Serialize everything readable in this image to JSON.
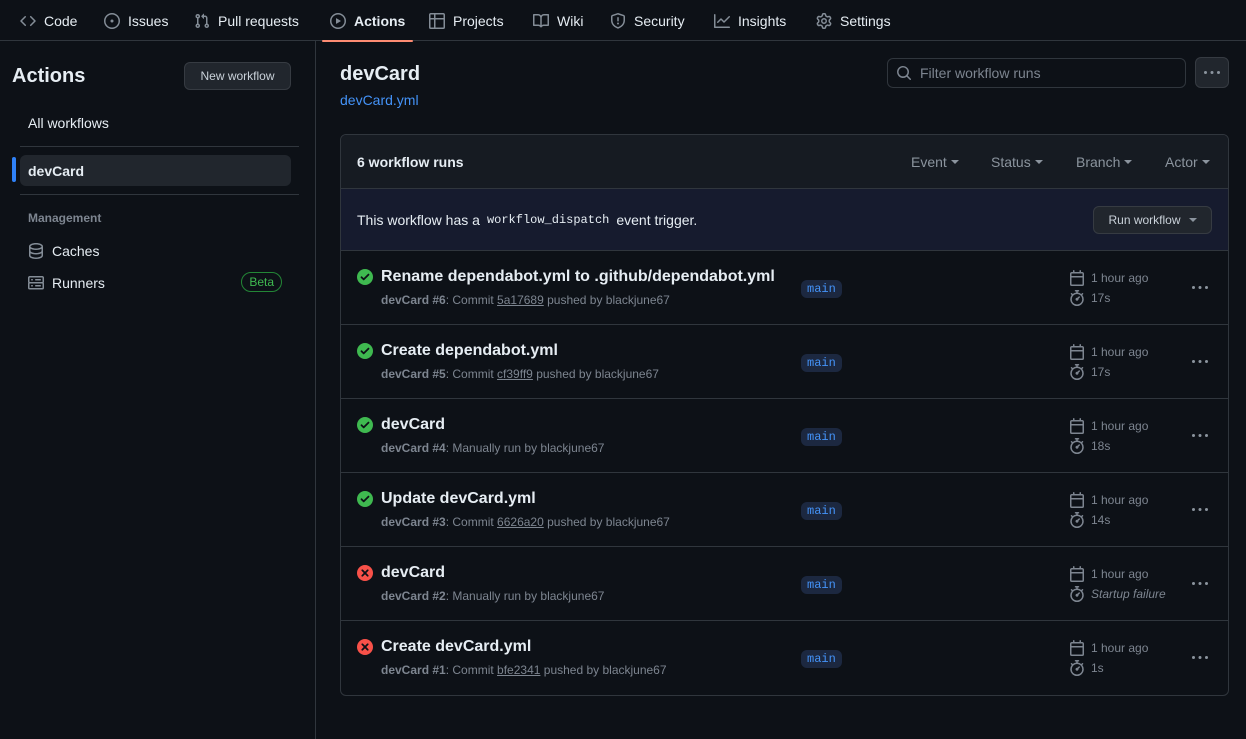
{
  "topnav": {
    "tabs": [
      {
        "label": "Code",
        "icon": "code-icon"
      },
      {
        "label": "Issues",
        "icon": "issue-opened-icon"
      },
      {
        "label": "Pull requests",
        "icon": "git-pull-request-icon"
      },
      {
        "label": "Actions",
        "icon": "play-icon",
        "selected": true
      },
      {
        "label": "Projects",
        "icon": "table-icon"
      },
      {
        "label": "Wiki",
        "icon": "book-icon"
      },
      {
        "label": "Security",
        "icon": "shield-icon"
      },
      {
        "label": "Insights",
        "icon": "graph-icon"
      },
      {
        "label": "Settings",
        "icon": "gear-icon"
      }
    ]
  },
  "sidebar": {
    "title": "Actions",
    "new_workflow_label": "New workflow",
    "all_workflows_label": "All workflows",
    "workflows": [
      {
        "label": "devCard",
        "active": true
      }
    ],
    "management_heading": "Management",
    "management_items": [
      {
        "label": "Caches",
        "icon": "database-icon"
      },
      {
        "label": "Runners",
        "icon": "server-icon",
        "badge": "Beta"
      }
    ]
  },
  "main": {
    "workflow_name": "devCard",
    "workflow_file": "devCard.yml",
    "search_placeholder": "Filter workflow runs",
    "runs_count": "6 workflow runs",
    "filters": [
      "Event",
      "Status",
      "Branch",
      "Actor"
    ],
    "dispatch": {
      "prefix": "This workflow has a",
      "code": "workflow_dispatch",
      "suffix": "event trigger.",
      "button_label": "Run workflow"
    },
    "runs": [
      {
        "title": "Rename dependabot.yml to .github/dependabot.yml",
        "status": "success",
        "workflow": "devCard #6",
        "sep": ": ",
        "desc_prefix": "Commit ",
        "sha": "5a17689",
        "desc_suffix": " pushed by blackjune67",
        "branch": "main",
        "time": "1 hour ago",
        "duration": "17s"
      },
      {
        "title": "Create dependabot.yml",
        "status": "success",
        "workflow": "devCard #5",
        "sep": ": ",
        "desc_prefix": "Commit ",
        "sha": "cf39ff9",
        "desc_suffix": " pushed by blackjune67",
        "branch": "main",
        "time": "1 hour ago",
        "duration": "17s"
      },
      {
        "title": "devCard",
        "status": "success",
        "workflow": "devCard #4",
        "sep": ": ",
        "desc_prefix": "Manually run by blackjune67",
        "sha": "",
        "desc_suffix": "",
        "branch": "main",
        "time": "1 hour ago",
        "duration": "18s"
      },
      {
        "title": "Update devCard.yml",
        "status": "success",
        "workflow": "devCard #3",
        "sep": ": ",
        "desc_prefix": "Commit ",
        "sha": "6626a20",
        "desc_suffix": " pushed by blackjune67",
        "branch": "main",
        "time": "1 hour ago",
        "duration": "14s"
      },
      {
        "title": "devCard",
        "status": "failure",
        "workflow": "devCard #2",
        "sep": ": ",
        "desc_prefix": "Manually run by blackjune67",
        "sha": "",
        "desc_suffix": "",
        "branch": "main",
        "time": "1 hour ago",
        "duration": "Startup failure"
      },
      {
        "title": "Create devCard.yml",
        "status": "failure",
        "workflow": "devCard #1",
        "sep": ": ",
        "desc_prefix": "Commit ",
        "sha": "bfe2341",
        "desc_suffix": " pushed by blackjune67",
        "branch": "main",
        "time": "1 hour ago",
        "duration": "1s"
      }
    ]
  },
  "colors": {
    "success": "#3fb950",
    "failure": "#f85149",
    "accent": "#2f81f7",
    "tab_underline": "#fd8c73"
  }
}
